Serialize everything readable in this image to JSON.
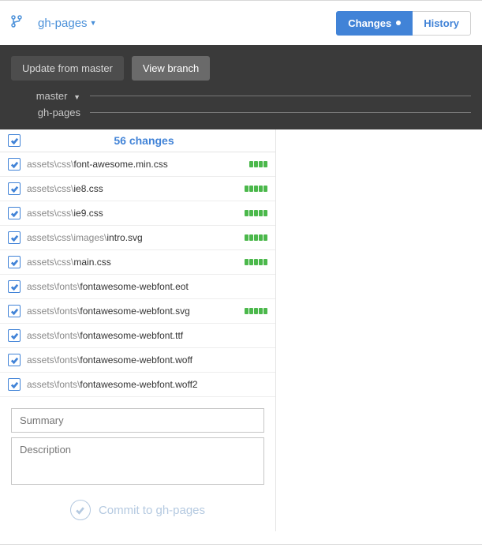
{
  "header": {
    "branch_name": "gh-pages",
    "tabs": {
      "changes": "Changes",
      "history": "History"
    }
  },
  "darkbar": {
    "update_btn": "Update from master",
    "view_btn": "View branch",
    "compare_base": "master",
    "compare_head": "gh-pages"
  },
  "changes": {
    "header": "56 changes",
    "files": [
      {
        "dir": "assets\\css\\",
        "name": "font-awesome.min.css",
        "blocks": 4
      },
      {
        "dir": "assets\\css\\",
        "name": "ie8.css",
        "blocks": 5
      },
      {
        "dir": "assets\\css\\",
        "name": "ie9.css",
        "blocks": 5
      },
      {
        "dir": "assets\\css\\images\\",
        "name": "intro.svg",
        "blocks": 5
      },
      {
        "dir": "assets\\css\\",
        "name": "main.css",
        "blocks": 5
      },
      {
        "dir": "assets\\fonts\\",
        "name": "fontawesome-webfont.eot",
        "blocks": 0
      },
      {
        "dir": "assets\\fonts\\",
        "name": "fontawesome-webfont.svg",
        "blocks": 5
      },
      {
        "dir": "assets\\fonts\\",
        "name": "fontawesome-webfont.ttf",
        "blocks": 0
      },
      {
        "dir": "assets\\fonts\\",
        "name": "fontawesome-webfont.woff",
        "blocks": 0
      },
      {
        "dir": "assets\\fonts\\",
        "name": "fontawesome-webfont.woff2",
        "blocks": 0
      }
    ]
  },
  "commit": {
    "summary_placeholder": "Summary",
    "description_placeholder": "Description",
    "button_label": "Commit to gh-pages"
  }
}
